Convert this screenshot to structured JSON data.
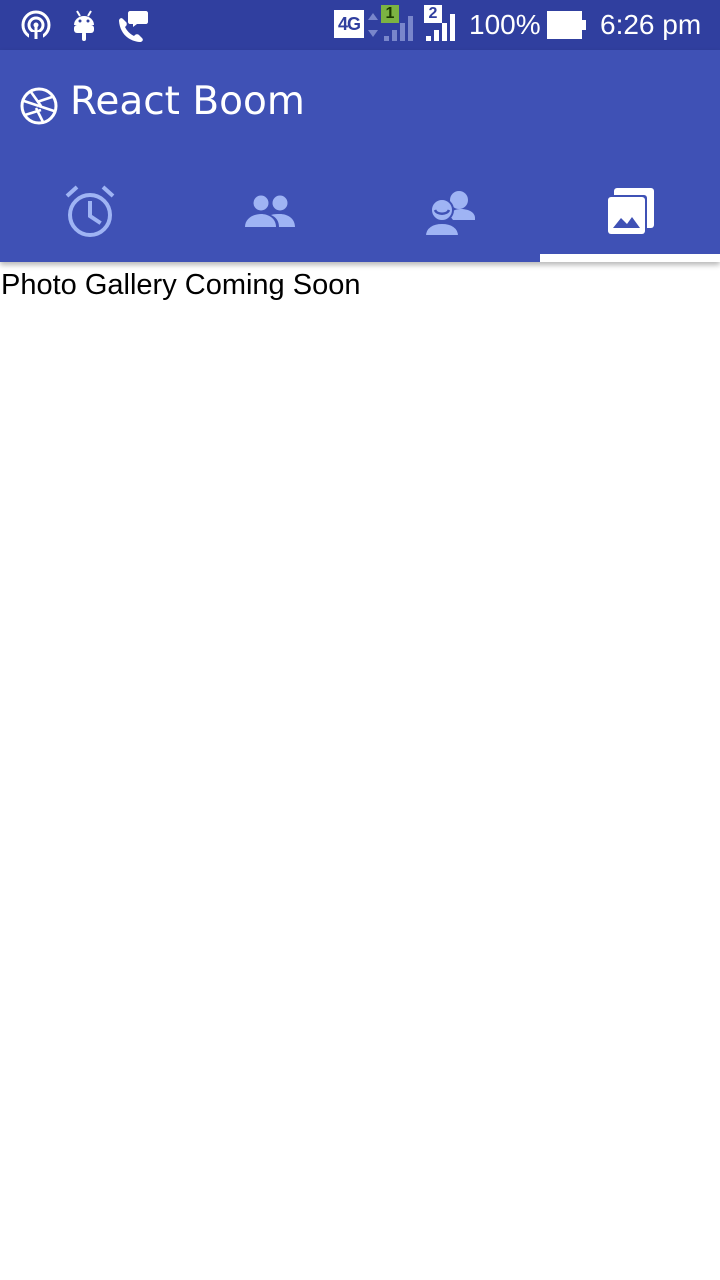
{
  "status_bar": {
    "left_icons": [
      "hotspot-icon",
      "android-debug-icon",
      "chat-icon"
    ],
    "network_type": "4G",
    "sim1_label": "1",
    "sim2_label": "2",
    "battery_percent": "100%",
    "time": "6:26 pm"
  },
  "app_bar": {
    "title": "React Boom",
    "logo_icon": "camera-aperture-icon",
    "background_color": "#3F51B5",
    "status_bar_color": "#303F9F"
  },
  "tabs": [
    {
      "icon": "alarm-clock-icon",
      "selected": false
    },
    {
      "icon": "people-icon",
      "selected": false
    },
    {
      "icon": "contacts-chat-icon",
      "selected": false
    },
    {
      "icon": "photo-library-icon",
      "selected": true
    }
  ],
  "colors": {
    "tab_inactive_icon": "#9FB4F4",
    "tab_active_icon": "#FFFFFF",
    "indicator": "#FFFFFF"
  },
  "main": {
    "message": "Photo Gallery Coming Soon"
  }
}
